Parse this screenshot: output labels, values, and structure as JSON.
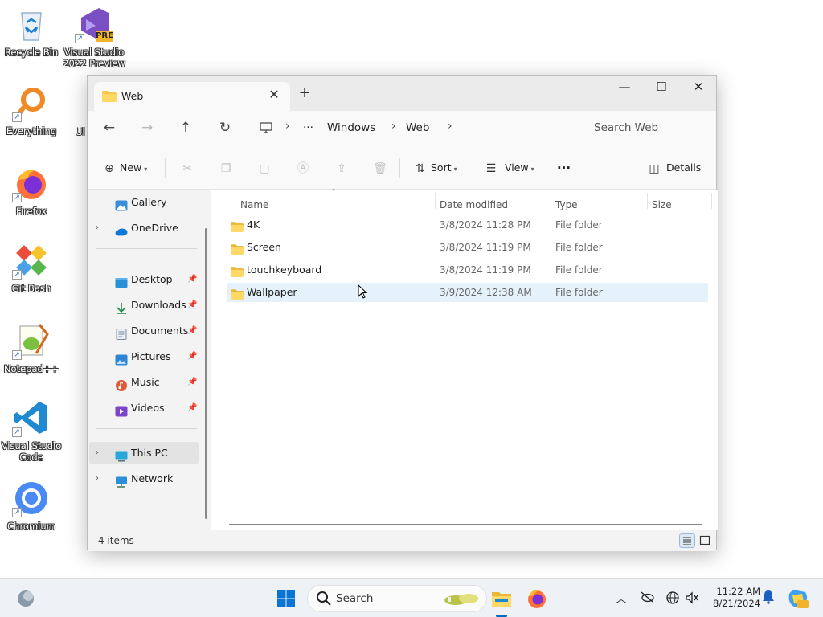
{
  "desktop": {
    "icons": [
      {
        "label": "Recycle Bin"
      },
      {
        "label": "Visual Studio 2022 Preview",
        "badge": "PRE"
      },
      {
        "label": "Everything"
      },
      {
        "label": "Firefox"
      },
      {
        "label": "Git Bash"
      },
      {
        "label": "Notepad++"
      },
      {
        "label": "Visual Studio Code"
      },
      {
        "label": "Chromium"
      },
      {
        "label": "Ul"
      }
    ]
  },
  "window": {
    "tab_title": "Web",
    "controls": {
      "minimize": "—",
      "maximize": "☐",
      "close": "✕"
    },
    "address": {
      "ellipsis": "···",
      "parts": [
        "Windows",
        "Web"
      ]
    },
    "search_placeholder": "Search Web",
    "commands": {
      "new": "New",
      "sort": "Sort",
      "view": "View",
      "more": "···",
      "details": "Details"
    },
    "sidebar": {
      "items": [
        {
          "label": "Gallery"
        },
        {
          "label": "OneDrive"
        },
        {
          "label": "Desktop"
        },
        {
          "label": "Downloads"
        },
        {
          "label": "Documents"
        },
        {
          "label": "Pictures"
        },
        {
          "label": "Music"
        },
        {
          "label": "Videos"
        },
        {
          "label": "This PC"
        },
        {
          "label": "Network"
        }
      ]
    },
    "columns": [
      "Name",
      "Date modified",
      "Type",
      "Size"
    ],
    "rows": [
      {
        "name": "4K",
        "date": "3/8/2024 11:28 PM",
        "type": "File folder"
      },
      {
        "name": "Screen",
        "date": "3/8/2024 11:19 PM",
        "type": "File folder"
      },
      {
        "name": "touchkeyboard",
        "date": "3/8/2024 11:19 PM",
        "type": "File folder"
      },
      {
        "name": "Wallpaper",
        "date": "3/9/2024 12:38 AM",
        "type": "File folder"
      }
    ],
    "status": "4 items"
  },
  "taskbar": {
    "search": "Search",
    "time": "11:22 AM",
    "date": "8/21/2024"
  },
  "colors": {
    "accent": "#0067c0",
    "folder": "#f4c84c",
    "hover_row": "#e5f1fb"
  }
}
